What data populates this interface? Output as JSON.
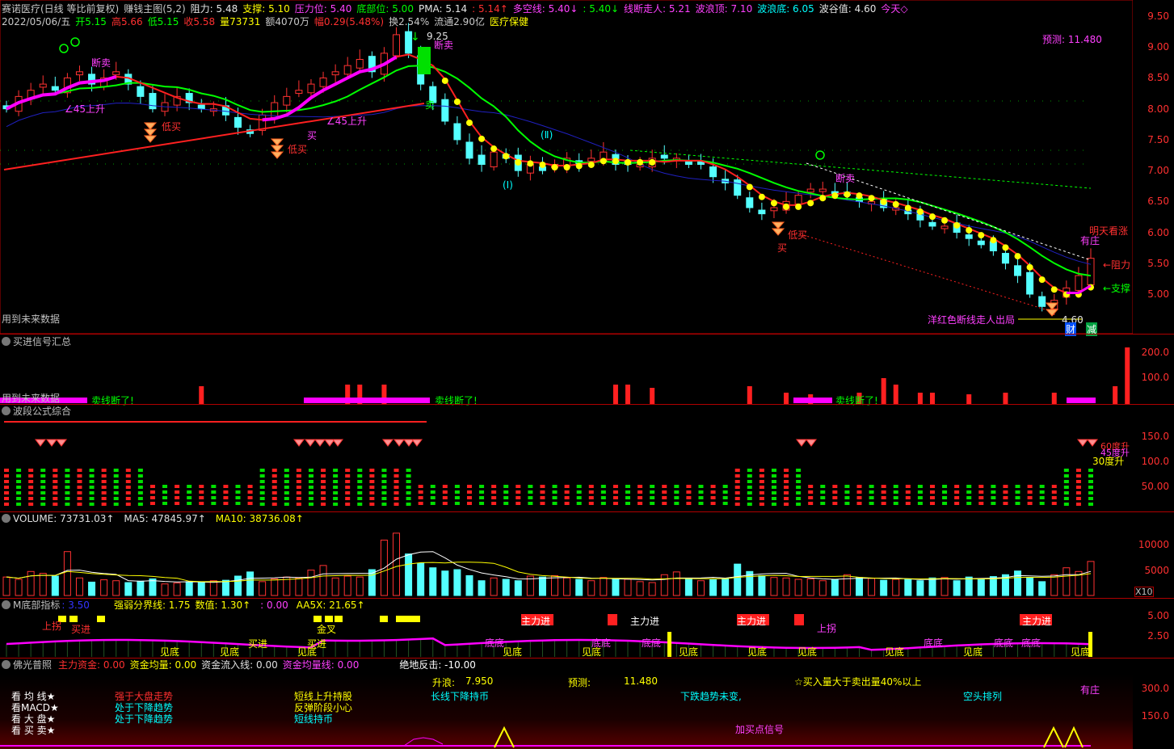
{
  "header": {
    "row1": [
      {
        "text": "赛诺医疗(日线 等比前复权)",
        "color": "#c8c8c8"
      },
      {
        "text": "赚钱主图(5,2)",
        "color": "#c8c8c8"
      },
      {
        "text": "阻力: 5.48",
        "color": "#e6e6e6"
      },
      {
        "text": "支撑: 5.10",
        "color": "#ffff00"
      },
      {
        "text": "压力位: 5.40",
        "color": "#ff40ff"
      },
      {
        "text": "底部位: 5.00",
        "color": "#00ff00"
      },
      {
        "text": "PMA: 5.14",
        "color": "#e6e6e6"
      },
      {
        "text": ": 5.14↑",
        "color": "#ff3030"
      },
      {
        "text": "多空线: 5.40↓",
        "color": "#ff40ff"
      },
      {
        "text": ": 5.40↓",
        "color": "#00ff00"
      },
      {
        "text": "线断走人: 5.21",
        "color": "#ff40ff"
      },
      {
        "text": "波浪顶: 7.10",
        "color": "#ff40ff"
      },
      {
        "text": "波浪底: 6.05",
        "color": "#00ffff"
      },
      {
        "text": "波谷值: 4.60",
        "color": "#e6e6e6"
      },
      {
        "text": "今天◇",
        "color": "#ff40ff"
      }
    ],
    "row2": [
      {
        "text": "2022/05/06/五",
        "color": "#c8c8c8"
      },
      {
        "text": "开5.15",
        "color": "#00ff00"
      },
      {
        "text": "高5.66",
        "color": "#ff3030"
      },
      {
        "text": "低5.15",
        "color": "#00ff00"
      },
      {
        "text": "收5.58",
        "color": "#ff3030"
      },
      {
        "text": "量73731",
        "color": "#ffff00"
      },
      {
        "text": "额4070万",
        "color": "#c8c8c8"
      },
      {
        "text": "幅0.29(5.48%)",
        "color": "#ff3030"
      },
      {
        "text": "换2.54%",
        "color": "#c8c8c8"
      },
      {
        "text": "流通2.90亿",
        "color": "#c8c8c8"
      },
      {
        "text": "医疗保健",
        "color": "#ffff00"
      }
    ]
  },
  "colors": {
    "up": "#ff3232",
    "down": "#54ffff",
    "green": "#00ff00",
    "magenta": "#ff00ff",
    "yellow": "#ffff00",
    "blue": "#3333ff",
    "frame": "#b00000"
  },
  "main_annotations": {
    "forecast": "预测:    11.480",
    "duanmai": "断卖",
    "angle_up": "∠45上升",
    "dimai": "低买",
    "mai": "买",
    "sell": "卖",
    "wave1": "(Ⅰ)",
    "wave2": "(Ⅱ)",
    "mingtian": "明天看涨",
    "youzhuang": "有庄",
    "zuli": "←阻力",
    "zhicheng": "←支撑",
    "exit_line": "洋红色断线走人出局",
    "low_price": "4.60",
    "cai": "财",
    "jian": "减",
    "future_data": "用到未来数据",
    "high_price": "9.25"
  },
  "panels": {
    "signal": {
      "title": "买进信号汇总",
      "sell_break": "卖线断了!",
      "future": "用到未来数据"
    },
    "wave": {
      "title": "波段公式综合",
      "deg60": "60度升",
      "deg45": "45度升",
      "deg30": "30度升"
    },
    "volume": {
      "title": "VOLUME: 73731.03↑",
      "ma5": "MA5: 47845.97↑",
      "ma10": "MA10: 38736.08↑",
      "x10": "X10"
    },
    "m_bottom": {
      "title": "M底部指标",
      "v1": ": 3.50",
      "v2": "强弱分界线: 1.75",
      "v3": "数值: 1.30↑",
      "v4": ": 0.00",
      "v5": "AA5X: 21.65↑",
      "zhulijin": "主力进",
      "jiandi": "见底",
      "didi": "底底",
      "shangjin": "上拐",
      "maijin": "买进",
      "jinru": "金叉"
    },
    "foguang": {
      "title": "佛光普照",
      "f1": "主力资金: 0.00",
      "f2": "资金均量: 0.00",
      "f3": "资金流入线: 0.00",
      "f4": "资金均量线: 0.00",
      "f5": "绝地反击: -10.00",
      "sl_label": "升浪:",
      "sl_val": "7.950",
      "yc_label": "预测:",
      "yc_val": "11.480",
      "buyvol": "☆买入量大于卖出量40%以上",
      "left_labels": [
        "看 均 线★",
        "看MACD★",
        "看 大 盘★",
        "看 买 卖★"
      ],
      "col2": [
        "强于大盘走势",
        "处于下降趋势",
        "处于下降趋势"
      ],
      "col3": [
        "短线上升持股",
        "反弹阶段小心",
        "短线持币"
      ],
      "col4": "长线下降持币",
      "col5": "下跌趋势未变,",
      "col6": "空头排列",
      "youzhuang": "有庄",
      "jiamai": "加买点信号"
    }
  },
  "axis": {
    "main": [
      "9.50",
      "9.00",
      "8.50",
      "8.00",
      "7.50",
      "7.00",
      "6.50",
      "6.00",
      "5.50",
      "5.00"
    ],
    "signal": [
      "200.0",
      "100.0"
    ],
    "wave": [
      "150.0",
      "100.0",
      "50.00"
    ],
    "volume": [
      "10000",
      "5000"
    ],
    "m": [
      "5.00",
      "2.50"
    ],
    "fg": [
      "300.0",
      "150.0"
    ]
  },
  "chart_data": {
    "type": "candlestick",
    "title": "赛诺医疗(日线 等比前复权)",
    "last_bar": {
      "date": "2022/05/06",
      "open": 5.15,
      "high": 5.66,
      "low": 5.15,
      "close": 5.58,
      "volume": 73731
    },
    "ylim": [
      4.6,
      9.6
    ],
    "closes": [
      8.0,
      8.2,
      8.3,
      8.4,
      8.3,
      8.5,
      8.6,
      8.4,
      8.5,
      8.6,
      8.4,
      8.2,
      8.0,
      8.1,
      8.2,
      8.1,
      8.0,
      8.0,
      7.9,
      7.7,
      7.6,
      7.9,
      8.1,
      8.2,
      8.3,
      8.4,
      8.5,
      8.6,
      8.7,
      8.8,
      8.6,
      8.9,
      9.2,
      8.9,
      8.4,
      8.1,
      7.8,
      7.5,
      7.2,
      7.1,
      7.3,
      7.2,
      7.0,
      7.1,
      7.0,
      7.1,
      7.2,
      7.1,
      7.2,
      7.3,
      7.1,
      7.1,
      7.1,
      7.2,
      7.2,
      7.2,
      7.1,
      7.1,
      6.9,
      6.8,
      6.6,
      6.4,
      6.3,
      6.4,
      6.5,
      6.6,
      6.7,
      6.7,
      6.6,
      6.6,
      6.5,
      6.5,
      6.4,
      6.4,
      6.3,
      6.2,
      6.1,
      6.1,
      6.0,
      5.9,
      5.8,
      5.7,
      5.5,
      5.3,
      5.0,
      4.8,
      4.9,
      5.1,
      5.3,
      5.58
    ],
    "volumes": [
      4000,
      3500,
      5200,
      4800,
      4200,
      9500,
      3800,
      2900,
      3400,
      3200,
      2800,
      3100,
      3600,
      2500,
      2700,
      3000,
      2800,
      3200,
      3300,
      4200,
      5100,
      3000,
      3600,
      4000,
      3800,
      5500,
      6500,
      3800,
      4200,
      4000,
      5600,
      12000,
      13500,
      9000,
      7000,
      6000,
      5300,
      5600,
      4300,
      3200,
      3800,
      3500,
      3200,
      4200,
      4000,
      4300,
      3800,
      3500,
      3200,
      3900,
      3600,
      3500,
      3000,
      2800,
      4500,
      5100,
      3500,
      3200,
      3400,
      3600,
      6800,
      5200,
      4300,
      3900,
      3800,
      3500,
      3600,
      3200,
      3400,
      4500,
      3900,
      3700,
      3300,
      3500,
      3600,
      3200,
      3800,
      3900,
      3200,
      4000,
      3600,
      4100,
      4500,
      5300,
      3800,
      3000,
      4500,
      6000,
      5200,
      7373
    ],
    "ma5_volume": 47845.97,
    "ma10_volume": 38736.08,
    "indicators": {
      "resistance": 5.48,
      "support": 5.1,
      "pressure": 5.4,
      "bottom": 5.0,
      "pma": 5.14,
      "wave_top": 7.1,
      "wave_bottom": 6.05,
      "wave_trough": 4.6,
      "forecast": 11.48,
      "rise_wave": 7.95
    }
  }
}
